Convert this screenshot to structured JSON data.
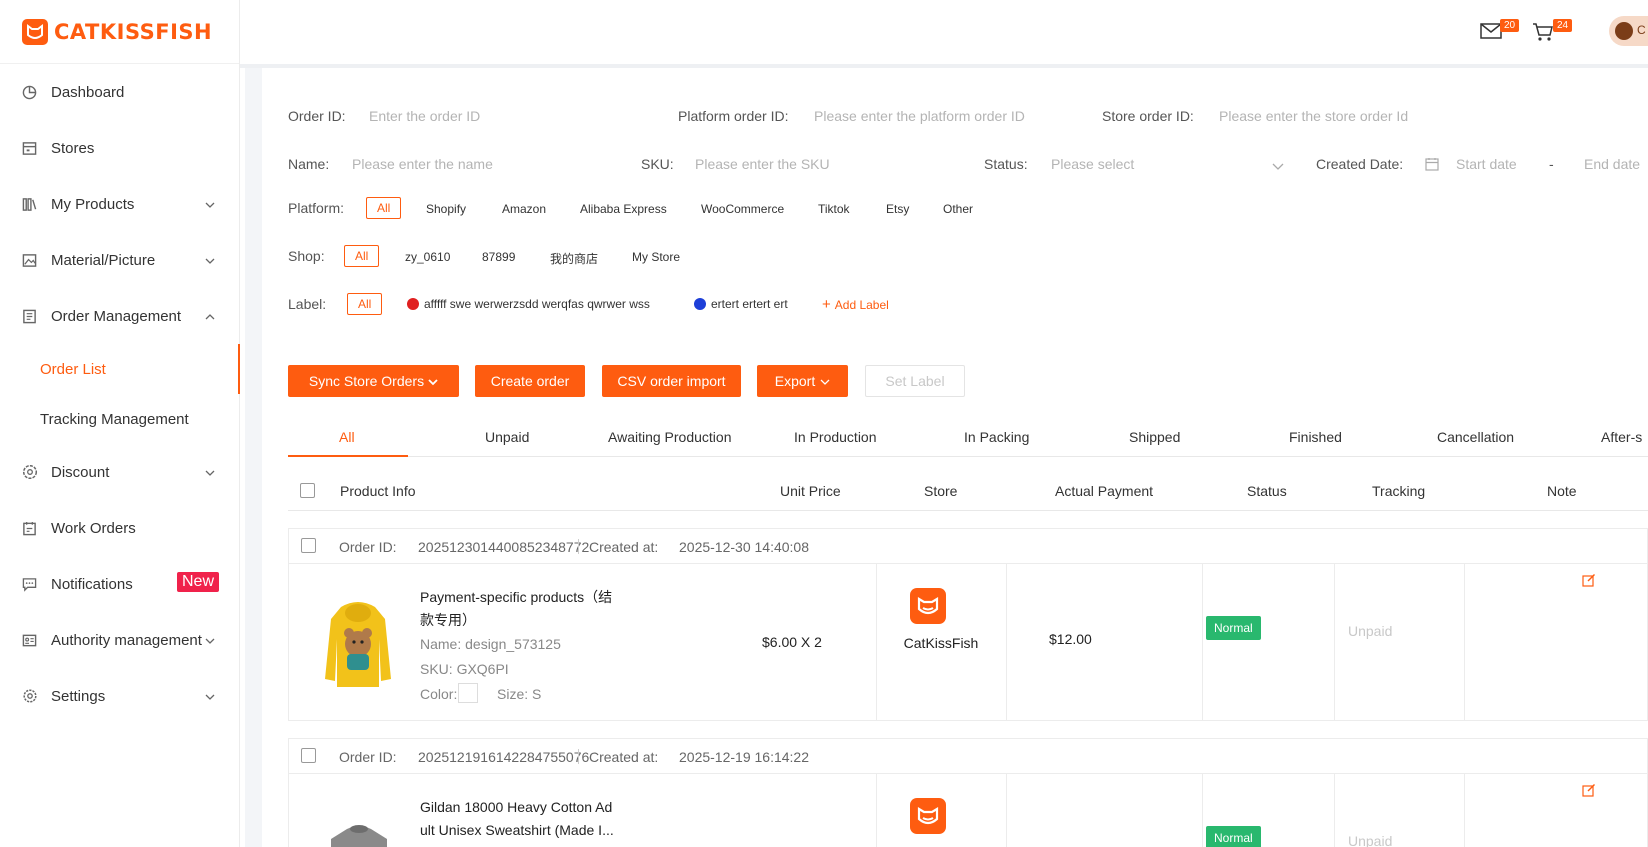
{
  "brand": {
    "name": "CATKISSFISH"
  },
  "topbar": {
    "mail_count": "20",
    "cart_count": "24",
    "avatar_text": "C"
  },
  "sidebar": {
    "items": [
      {
        "label": "Dashboard"
      },
      {
        "label": "Stores"
      },
      {
        "label": "My Products"
      },
      {
        "label": "Material/Picture"
      },
      {
        "label": "Order Management"
      },
      {
        "label": "Discount"
      },
      {
        "label": "Work Orders"
      },
      {
        "label": "Notifications",
        "badge": "New"
      },
      {
        "label": "Authority management"
      },
      {
        "label": "Settings"
      }
    ],
    "sub_items": [
      {
        "label": "Order List"
      },
      {
        "label": "Tracking Management"
      }
    ]
  },
  "filters": {
    "order_id": {
      "label": "Order ID:",
      "placeholder": "Enter the order ID"
    },
    "platform_order_id": {
      "label": "Platform order ID:",
      "placeholder": "Please enter the platform order ID"
    },
    "store_order_id": {
      "label": "Store order ID:",
      "placeholder": "Please enter the store order Id"
    },
    "name": {
      "label": "Name:",
      "placeholder": "Please enter the name"
    },
    "sku": {
      "label": "SKU:",
      "placeholder": "Please enter the SKU"
    },
    "status": {
      "label": "Status:",
      "placeholder": "Please select"
    },
    "created_date": {
      "label": "Created Date:",
      "start": "Start date",
      "sep": "-",
      "end": "End date"
    },
    "platform": {
      "label": "Platform:",
      "options": [
        "All",
        "Shopify",
        "Amazon",
        "Alibaba Express",
        "WooCommerce",
        "Tiktok",
        "Etsy",
        "Other"
      ]
    },
    "shop": {
      "label": "Shop:",
      "options": [
        "All",
        "zy_0610",
        "87899",
        "我的商店",
        "My Store"
      ]
    },
    "label": {
      "label": "Label:",
      "options": [
        "All"
      ],
      "tags": [
        {
          "text": "afffff swe werwerzsdd werqfas qwrwer wss",
          "color": "#e02020"
        },
        {
          "text": "ertert ertert ert",
          "color": "#1d3fd8"
        }
      ],
      "add": "Add Label"
    }
  },
  "actions": {
    "sync": "Sync Store Orders",
    "create": "Create order",
    "csv": "CSV order import",
    "export": "Export",
    "set_label": "Set Label"
  },
  "tabs": [
    "All",
    "Unpaid",
    "Awaiting Production",
    "In Production",
    "In Packing",
    "Shipped",
    "Finished",
    "Cancellation",
    "After-s"
  ],
  "table_headers": [
    "Product Info",
    "Unit Price",
    "Store",
    "Actual Payment",
    "Status",
    "Tracking",
    "Note"
  ],
  "orders": [
    {
      "id_label": "Order ID:",
      "id": "2025123014400852348772",
      "created_label": "Created at:",
      "created": "2025-12-30 14:40:08",
      "product_line1": "Payment-specific products（结",
      "product_line2": "款专用）",
      "name": "Name:  design_573125",
      "sku": "SKU:   GXQ6PI",
      "color_label": "Color:",
      "size": "Size:  S",
      "unit_price": "$6.00 X 2",
      "store": "CatKissFish",
      "payment": "$12.00",
      "status": "Normal",
      "tracking": "Unpaid"
    },
    {
      "id_label": "Order ID:",
      "id": "2025121916142284755076",
      "created_label": "Created at:",
      "created": "2025-12-19 16:14:22",
      "product_line1": "Gildan 18000 Heavy Cotton Ad",
      "product_line2": "ult Unisex Sweatshirt (Made I...",
      "status": "Normal",
      "tracking": "Unpaid"
    }
  ]
}
